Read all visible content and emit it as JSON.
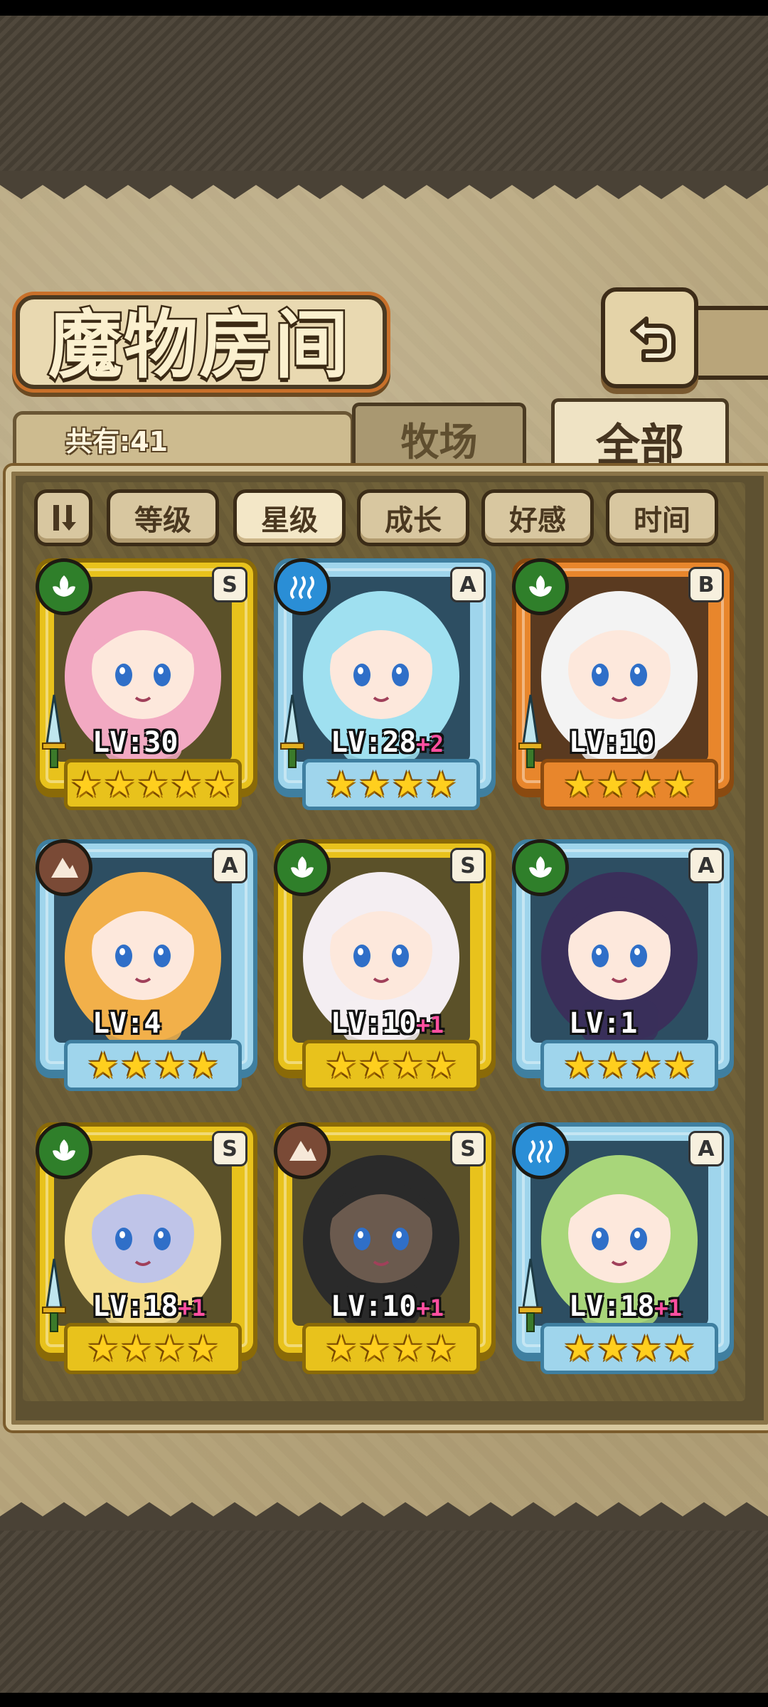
{
  "screen": {
    "title": "魔物房间",
    "count_label": "共有:41",
    "tabs": [
      {
        "label": "牧场",
        "active": false
      },
      {
        "label": "全部",
        "active": true
      }
    ],
    "sort_buttons": [
      {
        "label": "等级",
        "active": false
      },
      {
        "label": "星级",
        "active": true
      },
      {
        "label": "成长",
        "active": false
      },
      {
        "label": "好感",
        "active": false
      },
      {
        "label": "时间",
        "active": false
      }
    ]
  },
  "monsters": [
    {
      "element": "nature",
      "rank": "S",
      "level_text": "LV:30",
      "bonus": "",
      "stars": 5,
      "equipped": true,
      "frame": "gold"
    },
    {
      "element": "water",
      "rank": "A",
      "level_text": "LV:28",
      "bonus": "+2",
      "stars": 4,
      "equipped": true,
      "frame": "blue"
    },
    {
      "element": "nature",
      "rank": "B",
      "level_text": "LV:10",
      "bonus": "",
      "stars": 4,
      "equipped": true,
      "frame": "orange"
    },
    {
      "element": "earth",
      "rank": "A",
      "level_text": "LV:4",
      "bonus": "",
      "stars": 4,
      "equipped": false,
      "frame": "blue"
    },
    {
      "element": "nature",
      "rank": "S",
      "level_text": "LV:10",
      "bonus": "+1",
      "stars": 4,
      "equipped": false,
      "frame": "gold"
    },
    {
      "element": "nature",
      "rank": "A",
      "level_text": "LV:1",
      "bonus": "",
      "stars": 4,
      "equipped": false,
      "frame": "blue"
    },
    {
      "element": "nature",
      "rank": "S",
      "level_text": "LV:18",
      "bonus": "+1",
      "stars": 4,
      "equipped": true,
      "frame": "gold"
    },
    {
      "element": "earth",
      "rank": "S",
      "level_text": "LV:10",
      "bonus": "+1",
      "stars": 4,
      "equipped": false,
      "frame": "gold"
    },
    {
      "element": "water",
      "rank": "A",
      "level_text": "LV:18",
      "bonus": "+1",
      "stars": 4,
      "equipped": true,
      "frame": "blue"
    }
  ],
  "colors": {
    "gold_frame": "#e8c21c",
    "blue_frame": "#9fd5ec",
    "orange_frame": "#e8862c",
    "nature": "#2f7f2a",
    "water": "#2a8ed6",
    "earth": "#7a4a36",
    "star": "#ffcf1e",
    "bonus": "#ff4fa0"
  }
}
